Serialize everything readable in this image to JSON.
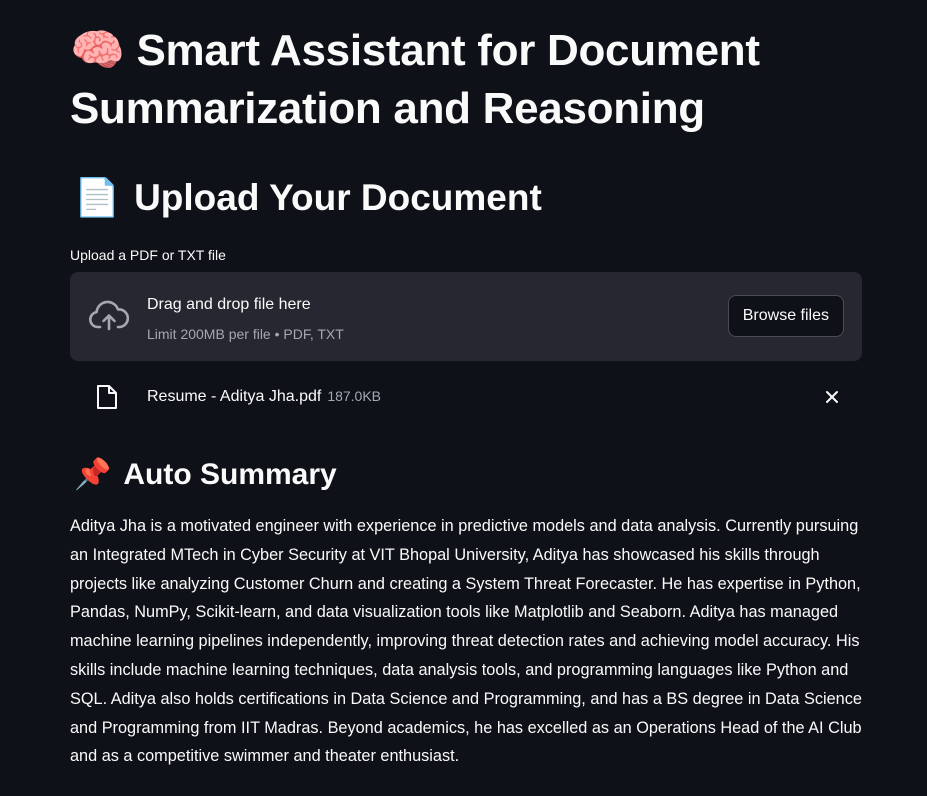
{
  "title": {
    "emoji": "🧠",
    "text": "Smart Assistant for Document Summarization and Reasoning"
  },
  "upload_section": {
    "emoji": "📄",
    "heading": "Upload Your Document",
    "label": "Upload a PDF or TXT file",
    "dropzone": {
      "title": "Drag and drop file here",
      "subtitle": "Limit 200MB per file • PDF, TXT",
      "icon": "cloud-upload-icon"
    },
    "browse_label": "Browse files",
    "file": {
      "icon": "file-icon",
      "name": "Resume - Aditya Jha.pdf",
      "size": "187.0KB",
      "remove_icon": "close-icon"
    }
  },
  "summary_section": {
    "emoji": "📌",
    "heading": "Auto Summary",
    "text": "Aditya Jha is a motivated engineer with experience in predictive models and data analysis. Currently pursuing an Integrated MTech in Cyber Security at VIT Bhopal University, Aditya has showcased his skills through projects like analyzing Customer Churn and creating a System Threat Forecaster. He has expertise in Python, Pandas, NumPy, Scikit-learn, and data visualization tools like Matplotlib and Seaborn. Aditya has managed machine learning pipelines independently, improving threat detection rates and achieving model accuracy. His skills include machine learning techniques, data analysis tools, and programming languages like Python and SQL. Aditya also holds certifications in Data Science and Programming, and has a BS degree in Data Science and Programming from IIT Madras. Beyond academics, he has excelled as an Operations Head of the AI Club and as a competitive swimmer and theater enthusiast."
  },
  "colors": {
    "background": "#0e1117",
    "panel": "#262730",
    "text": "#fafafa",
    "muted": "#a3a8b4"
  }
}
